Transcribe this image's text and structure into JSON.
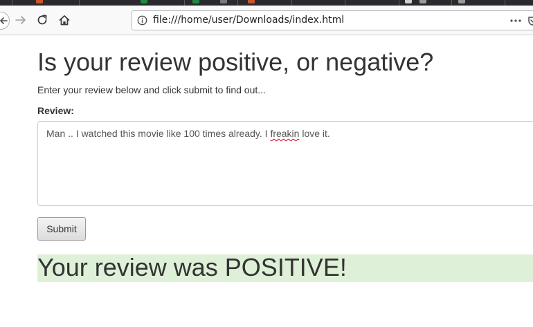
{
  "browser": {
    "url": "file:///home/user/Downloads/index.html",
    "back_icon": "arrow-left-icon",
    "forward_icon": "arrow-right-icon",
    "reload_icon": "reload-icon",
    "home_icon": "home-icon",
    "page_actions_icon": "more-horizontal-icon",
    "pocket_icon": "pocket-icon",
    "info_icon": "info-icon"
  },
  "page": {
    "title": "Is your review positive, or negative?",
    "intro": "Enter your review below and click submit to find out...",
    "review_label": "Review:",
    "review_text_before": "Man .. I watched this movie like 100 times already. I ",
    "review_text_misspelled": "freakin",
    "review_text_after": " love it.",
    "submit_label": "Submit",
    "result": "Your review was POSITIVE!",
    "result_background": "#dff0d8"
  }
}
